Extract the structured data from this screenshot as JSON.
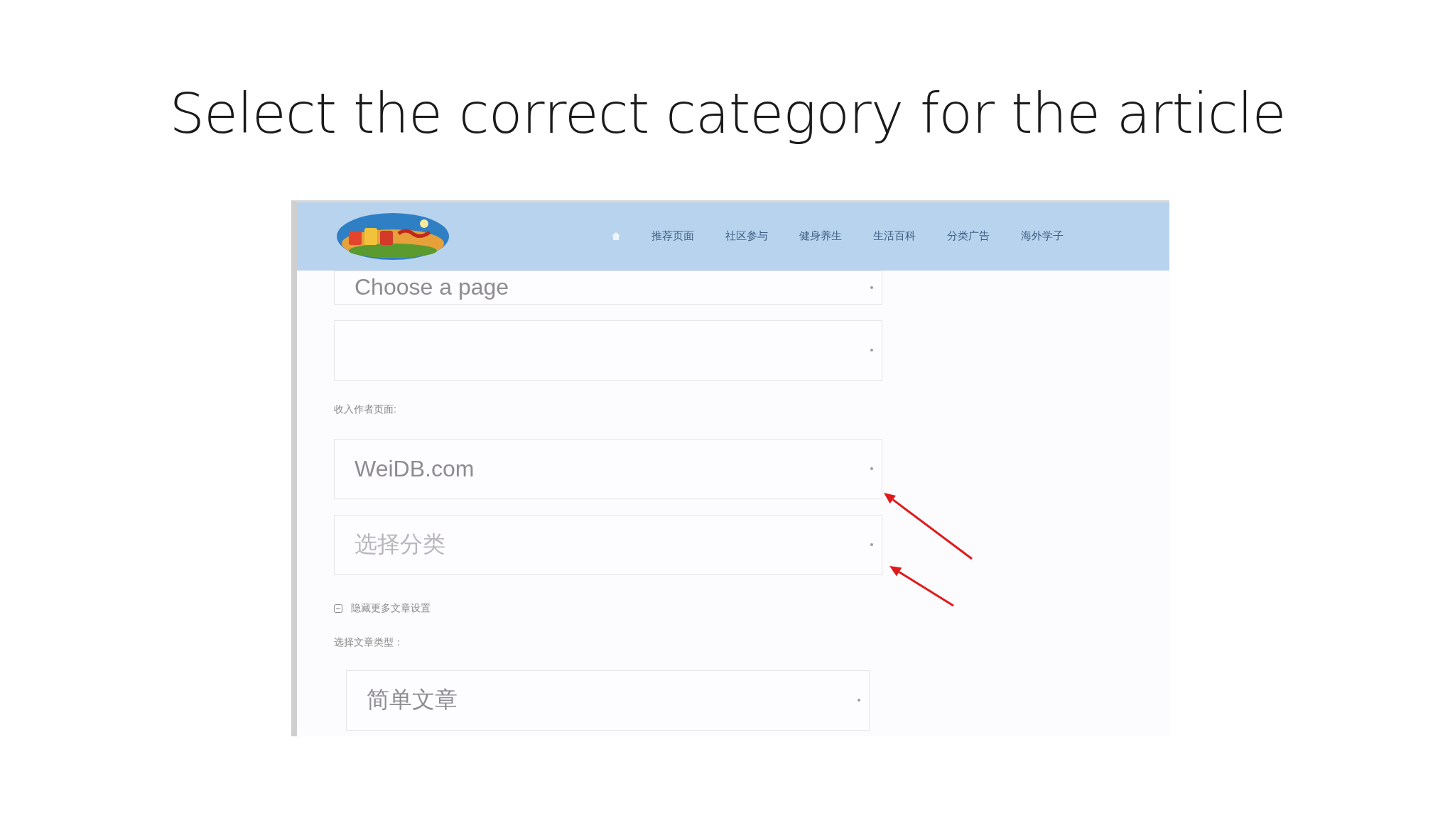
{
  "slide": {
    "title": "Select the correct category for the article"
  },
  "screenshot": {
    "nav": {
      "items": [
        "推荐页面",
        "社区参与",
        "健身养生",
        "生活百科",
        "分类广告",
        "海外学子"
      ]
    },
    "fields": [
      {
        "kind": "select",
        "value": "Choose a page"
      },
      {
        "kind": "select"
      },
      {
        "kind": "label",
        "text": "收入作者页面:"
      },
      {
        "kind": "select",
        "value": "WeiDB.com",
        "arrow": true
      },
      {
        "kind": "select",
        "placeholder": "选择分类",
        "arrow": true
      },
      {
        "kind": "toggle",
        "text": "隐藏更多文章设置",
        "expanded": true
      },
      {
        "kind": "label",
        "text": "选择文章类型："
      },
      {
        "kind": "select",
        "value": "简单文章",
        "indented": true
      }
    ]
  }
}
